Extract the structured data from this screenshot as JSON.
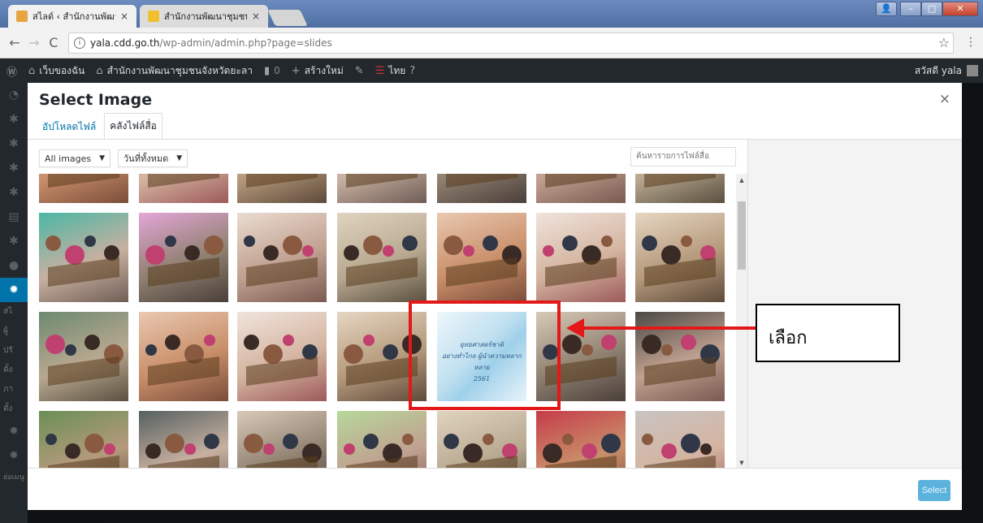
{
  "browser": {
    "tabs": [
      {
        "label": "สไลด์ ‹ สำนักงานพัฒนาชุมชน",
        "active": true,
        "favicon_color": "#e8a440"
      },
      {
        "label": "สำนักงานพัฒนาชุมชนจังหวัด",
        "active": false,
        "favicon_color": "#f0c030"
      }
    ],
    "tab_close": "×",
    "url_host": "yala.cdd.go.th",
    "url_path": "/wp-admin/admin.php?page=slides",
    "back": "←",
    "forward": "→",
    "reload": "C",
    "info": "i",
    "star": "☆",
    "menu": "⋮",
    "win_min": "–",
    "win_max": "□",
    "win_close": "✕",
    "win_person": "👤"
  },
  "adminbar": {
    "my_sites": "เว็บของฉัน",
    "site_name": "สำนักงานพัฒนาชุมชนจังหวัดยะลา",
    "comments": "0",
    "new": "สร้างใหม่",
    "language": "ไทย",
    "howdy": "สวัสดี yala"
  },
  "adminmenu": {
    "labels": [
      "สไ",
      "ผู้",
      "ปรั",
      "ตั้ง",
      "ภา",
      "ตั้ง"
    ],
    "collapse": "ย่อเมนู"
  },
  "modal": {
    "title": "Select Image",
    "close": "×",
    "tabs": [
      {
        "label": "อัปโหลดไฟล์",
        "active": false
      },
      {
        "label": "คลังไฟล์สื่อ",
        "active": true
      }
    ],
    "filter_type": "All images",
    "filter_date": "วันที่ทั้งหมด",
    "search_placeholder": "ค้นหารายการไฟล์สื่อ",
    "select_button": "Select",
    "featured_text": "ยุทธศาสตร์ชาติ\nอย่างทำไกล ผู้นำความหลากหลาย\n2561",
    "scroll_up": "▲",
    "scroll_down": "▼",
    "filter_arrow": "▼"
  },
  "annotation": {
    "label": "เลือก",
    "color": "#e31818"
  },
  "colors": {
    "wp_blue": "#0073aa",
    "select_button": "#5bb3dd",
    "admin_bg": "#23282d"
  }
}
